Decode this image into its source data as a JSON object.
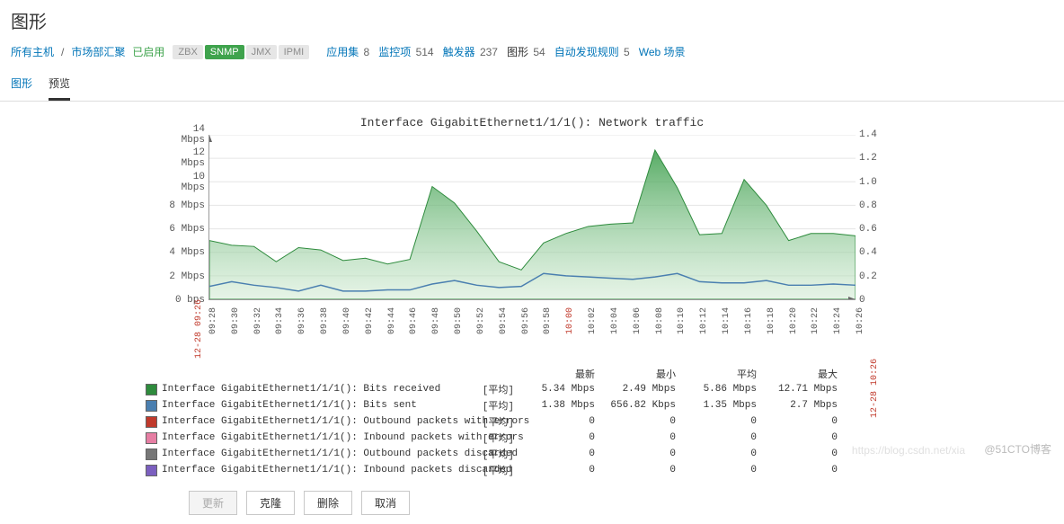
{
  "page": {
    "title": "图形"
  },
  "nav": {
    "all_hosts": "所有主机",
    "hostgroup": "市场部汇聚",
    "enabled": "已启用",
    "proto": {
      "zbx": "ZBX",
      "snmp": "SNMP",
      "jmx": "JMX",
      "ipmi": "IPMI"
    },
    "items": [
      {
        "label": "应用集",
        "count": "8"
      },
      {
        "label": "监控项",
        "count": "514"
      },
      {
        "label": "触发器",
        "count": "237"
      },
      {
        "label": "图形",
        "count": "54",
        "active": true
      },
      {
        "label": "自动发现规则",
        "count": "5"
      },
      {
        "label": "Web 场景",
        "count": ""
      }
    ]
  },
  "tabs": {
    "graph": "图形",
    "preview": "预览"
  },
  "chart_data": {
    "type": "area",
    "title": "Interface GigabitEthernet1/1/1(): Network traffic",
    "xlabel": "",
    "ylabel_left": "Mbps",
    "ylabel_right": "",
    "ylim_left": [
      0,
      14
    ],
    "ylim_right": [
      0,
      1.4
    ],
    "yticks_left": [
      "0 bps",
      "2 Mbps",
      "4 Mbps",
      "6 Mbps",
      "8 Mbps",
      "10 Mbps",
      "12 Mbps",
      "14 Mbps"
    ],
    "yticks_right": [
      "0",
      "0.2",
      "0.4",
      "0.6",
      "0.8",
      "1.0",
      "1.2",
      "1.4"
    ],
    "x": [
      "09:28",
      "09:30",
      "09:32",
      "09:34",
      "09:36",
      "09:38",
      "09:40",
      "09:42",
      "09:44",
      "09:46",
      "09:48",
      "09:50",
      "09:52",
      "09:54",
      "09:56",
      "09:58",
      "10:00",
      "10:02",
      "10:04",
      "10:06",
      "10:08",
      "10:10",
      "10:12",
      "10:14",
      "10:16",
      "10:18",
      "10:20",
      "10:22",
      "10:24",
      "10:26"
    ],
    "x_red": [
      "10:00"
    ],
    "x_side_left": "12-28 09:26",
    "x_side_right": "12-28 10:26",
    "series": [
      {
        "name": "Interface GigabitEthernet1/1/1(): Bits received",
        "color": "#2e8b3d",
        "fill": true,
        "values": [
          5.0,
          4.6,
          4.5,
          3.2,
          4.4,
          4.2,
          3.3,
          3.5,
          3.0,
          3.4,
          9.6,
          8.2,
          5.8,
          3.2,
          2.5,
          4.8,
          5.6,
          6.2,
          6.4,
          6.5,
          12.7,
          9.5,
          5.5,
          5.6,
          10.2,
          8.0,
          5.0,
          5.6,
          5.6,
          5.4
        ]
      },
      {
        "name": "Interface GigabitEthernet1/1/1(): Bits sent",
        "color": "#4a7fb0",
        "fill": false,
        "values": [
          1.1,
          1.5,
          1.2,
          1.0,
          0.7,
          1.2,
          0.7,
          0.7,
          0.8,
          0.8,
          1.3,
          1.6,
          1.2,
          1.0,
          1.1,
          2.2,
          2.0,
          1.9,
          1.8,
          1.7,
          1.9,
          2.2,
          1.5,
          1.4,
          1.4,
          1.6,
          1.2,
          1.2,
          1.3,
          1.2
        ]
      },
      {
        "name": "Interface GigabitEthernet1/1/1(): Outbound packets with errors",
        "color": "#c0392b",
        "fill": false,
        "values": [
          0,
          0,
          0,
          0,
          0,
          0,
          0,
          0,
          0,
          0,
          0,
          0,
          0,
          0,
          0,
          0,
          0,
          0,
          0,
          0,
          0,
          0,
          0,
          0,
          0,
          0,
          0,
          0,
          0,
          0
        ]
      },
      {
        "name": "Interface GigabitEthernet1/1/1(): Inbound packets with errors",
        "color": "#e67ea3",
        "fill": false,
        "values": [
          0,
          0,
          0,
          0,
          0,
          0,
          0,
          0,
          0,
          0,
          0,
          0,
          0,
          0,
          0,
          0,
          0,
          0,
          0,
          0,
          0,
          0,
          0,
          0,
          0,
          0,
          0,
          0,
          0,
          0
        ]
      },
      {
        "name": "Interface GigabitEthernet1/1/1(): Outbound packets discarded",
        "color": "#777777",
        "fill": false,
        "values": [
          0,
          0,
          0,
          0,
          0,
          0,
          0,
          0,
          0,
          0,
          0,
          0,
          0,
          0,
          0,
          0,
          0,
          0,
          0,
          0,
          0,
          0,
          0,
          0,
          0,
          0,
          0,
          0,
          0,
          0
        ]
      },
      {
        "name": "Interface GigabitEthernet1/1/1(): Inbound packets discarded",
        "color": "#7b5fbf",
        "fill": false,
        "values": [
          0,
          0,
          0,
          0,
          0,
          0,
          0,
          0,
          0,
          0,
          0,
          0,
          0,
          0,
          0,
          0,
          0,
          0,
          0,
          0,
          0,
          0,
          0,
          0,
          0,
          0,
          0,
          0,
          0,
          0
        ]
      }
    ],
    "legend_headers": [
      "最新",
      "最小",
      "平均",
      "最大"
    ],
    "agg_label": "[平均]",
    "legend_stats": [
      [
        "5.34 Mbps",
        "2.49 Mbps",
        "5.86 Mbps",
        "12.71 Mbps"
      ],
      [
        "1.38 Mbps",
        "656.82 Kbps",
        "1.35 Mbps",
        "2.7 Mbps"
      ],
      [
        "0",
        "0",
        "0",
        "0"
      ],
      [
        "0",
        "0",
        "0",
        "0"
      ],
      [
        "0",
        "0",
        "0",
        "0"
      ],
      [
        "0",
        "0",
        "0",
        "0"
      ]
    ]
  },
  "buttons": {
    "update": "更新",
    "clone": "克隆",
    "delete": "删除",
    "cancel": "取消"
  },
  "watermark": {
    "right": "@51CTO博客",
    "faint": "https://blog.csdn.net/xia"
  }
}
